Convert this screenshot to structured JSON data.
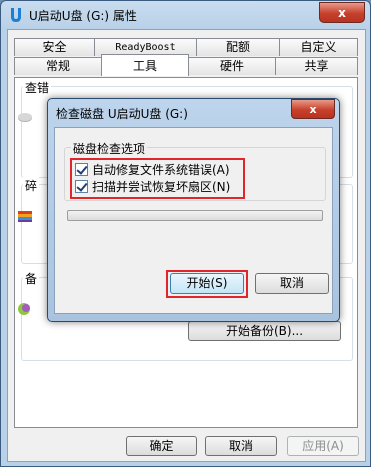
{
  "window": {
    "title": "U启动U盘 (G:) 属性",
    "close_label": "x"
  },
  "tabs_row1": [
    "安全",
    "ReadyBoost",
    "配额",
    "自定义"
  ],
  "tabs_row2": [
    "常规",
    "工具",
    "硬件",
    "共享"
  ],
  "active_tab": "工具",
  "panel": {
    "group1_label": "查错",
    "group2_label": "碎",
    "group3_label": "备",
    "backup_button": "开始备份(B)..."
  },
  "footer": {
    "ok": "确定",
    "cancel": "取消",
    "apply": "应用(A)"
  },
  "dialog": {
    "title": "检查磁盘 U启动U盘 (G:)",
    "close_label": "x",
    "options_group": "磁盘检查选项",
    "option1": "自动修复文件系统错误(A)",
    "option2": "扫描并尝试恢复坏扇区(N)",
    "option1_checked": true,
    "option2_checked": true,
    "progress": 0,
    "start_button": "开始(S)",
    "cancel_button": "取消"
  },
  "colors": {
    "highlight": "#e0262b",
    "title_bar": "#b9d1e8",
    "close": "#c7402c"
  }
}
